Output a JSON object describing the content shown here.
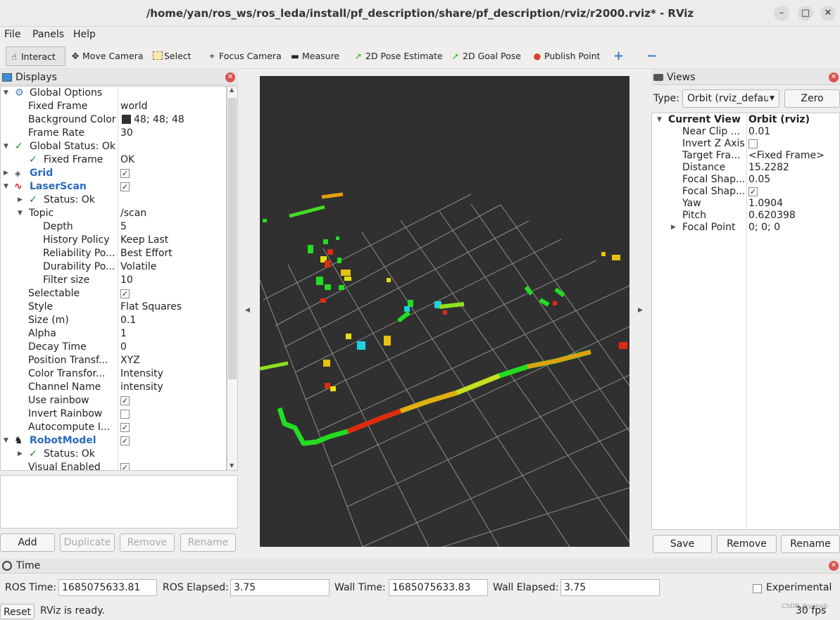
{
  "window": {
    "title": "/home/yan/ros_ws/ros_leda/install/pf_description/share/pf_description/rviz/r2000.rviz* - RViz"
  },
  "menu": [
    "File",
    "Panels",
    "Help"
  ],
  "toolbar": {
    "interact": "Interact",
    "move_camera": "Move Camera",
    "select": "Select",
    "focus_camera": "Focus Camera",
    "measure": "Measure",
    "pose_estimate": "2D Pose Estimate",
    "goal_pose": "2D Goal Pose",
    "publish_point": "Publish Point"
  },
  "displays": {
    "title": "Displays",
    "rows": [
      {
        "label": "Global Options",
        "value": ""
      },
      {
        "label": "Fixed Frame",
        "value": "world"
      },
      {
        "label": "Background Color",
        "value": "48; 48; 48"
      },
      {
        "label": "Frame Rate",
        "value": "30"
      },
      {
        "label": "Global Status: Ok",
        "value": ""
      },
      {
        "label": "Fixed Frame",
        "value": "OK"
      },
      {
        "label": "Grid",
        "value": ""
      },
      {
        "label": "LaserScan",
        "value": ""
      },
      {
        "label": "Status: Ok",
        "value": ""
      },
      {
        "label": "Topic",
        "value": "/scan"
      },
      {
        "label": "Depth",
        "value": "5"
      },
      {
        "label": "History Policy",
        "value": "Keep Last"
      },
      {
        "label": "Reliability Po...",
        "value": "Best Effort"
      },
      {
        "label": "Durability Po...",
        "value": "Volatile"
      },
      {
        "label": "Filter size",
        "value": "10"
      },
      {
        "label": "Selectable",
        "value": ""
      },
      {
        "label": "Style",
        "value": "Flat Squares"
      },
      {
        "label": "Size (m)",
        "value": "0.1"
      },
      {
        "label": "Alpha",
        "value": "1"
      },
      {
        "label": "Decay Time",
        "value": "0"
      },
      {
        "label": "Position Transf...",
        "value": "XYZ"
      },
      {
        "label": "Color Transfor...",
        "value": "Intensity"
      },
      {
        "label": "Channel Name",
        "value": "intensity"
      },
      {
        "label": "Use rainbow",
        "value": ""
      },
      {
        "label": "Invert Rainbow",
        "value": ""
      },
      {
        "label": "Autocompute I...",
        "value": ""
      },
      {
        "label": "RobotModel",
        "value": ""
      },
      {
        "label": "Status: Ok",
        "value": ""
      },
      {
        "label": "Visual Enabled",
        "value": ""
      }
    ],
    "buttons": {
      "add": "Add",
      "duplicate": "Duplicate",
      "remove": "Remove",
      "rename": "Rename"
    }
  },
  "views": {
    "title": "Views",
    "type_label": "Type:",
    "type_value": "Orbit (rviz_defau",
    "zero": "Zero",
    "rows": [
      {
        "label": "Current View",
        "value": "Orbit (rviz)"
      },
      {
        "label": "Near Clip ...",
        "value": "0.01"
      },
      {
        "label": "Invert Z Axis",
        "value": ""
      },
      {
        "label": "Target Fra...",
        "value": "<Fixed Frame>"
      },
      {
        "label": "Distance",
        "value": "15.2282"
      },
      {
        "label": "Focal Shap...",
        "value": "0.05"
      },
      {
        "label": "Focal Shap...",
        "value": ""
      },
      {
        "label": "Yaw",
        "value": "1.0904"
      },
      {
        "label": "Pitch",
        "value": "0.620398"
      },
      {
        "label": "Focal Point",
        "value": "0; 0; 0"
      }
    ],
    "buttons": {
      "save": "Save",
      "remove": "Remove",
      "rename": "Rename"
    }
  },
  "time": {
    "title": "Time",
    "ros_time_label": "ROS Time:",
    "ros_time": "1685075633.81",
    "ros_elapsed_label": "ROS Elapsed:",
    "ros_elapsed": "3.75",
    "wall_time_label": "Wall Time:",
    "wall_time": "1685075633.83",
    "wall_elapsed_label": "Wall Elapsed:",
    "wall_elapsed": "3.75",
    "experimental": "Experimental"
  },
  "status": {
    "reset": "Reset",
    "message": "RViz is ready.",
    "fps": "30 fps",
    "watermark": "CSDN @yanab"
  },
  "colors": {
    "background": "#303030",
    "grid": "#9a9a9a",
    "scan_green": "#22dd22",
    "scan_yellow": "#e8e010",
    "scan_red": "#e02a10",
    "scan_cyan": "#20d0e0"
  }
}
